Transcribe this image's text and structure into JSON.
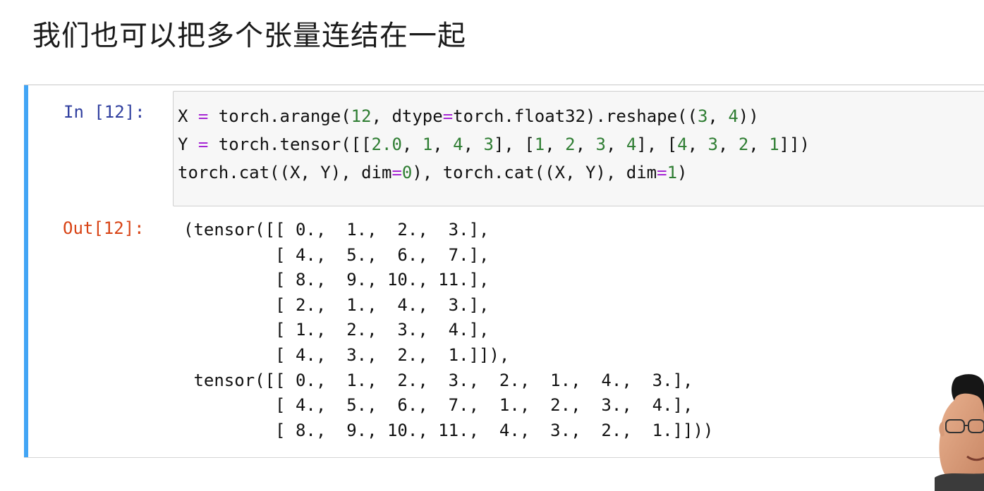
{
  "slide": {
    "title": "我们也可以把多个张量连结在一起"
  },
  "cell": {
    "in_prompt": "In [12]:",
    "out_prompt": "Out[12]:",
    "code_lines": [
      [
        {
          "t": "X ",
          "c": ""
        },
        {
          "t": "=",
          "c": "op"
        },
        {
          "t": " torch.arange(",
          "c": ""
        },
        {
          "t": "12",
          "c": "num"
        },
        {
          "t": ", dtype",
          "c": ""
        },
        {
          "t": "=",
          "c": "op"
        },
        {
          "t": "torch.float32).reshape((",
          "c": ""
        },
        {
          "t": "3",
          "c": "num"
        },
        {
          "t": ", ",
          "c": ""
        },
        {
          "t": "4",
          "c": "num"
        },
        {
          "t": "))",
          "c": ""
        }
      ],
      [
        {
          "t": "Y ",
          "c": ""
        },
        {
          "t": "=",
          "c": "op"
        },
        {
          "t": " torch.tensor([[",
          "c": ""
        },
        {
          "t": "2.0",
          "c": "num"
        },
        {
          "t": ", ",
          "c": ""
        },
        {
          "t": "1",
          "c": "num"
        },
        {
          "t": ", ",
          "c": ""
        },
        {
          "t": "4",
          "c": "num"
        },
        {
          "t": ", ",
          "c": ""
        },
        {
          "t": "3",
          "c": "num"
        },
        {
          "t": "], [",
          "c": ""
        },
        {
          "t": "1",
          "c": "num"
        },
        {
          "t": ", ",
          "c": ""
        },
        {
          "t": "2",
          "c": "num"
        },
        {
          "t": ", ",
          "c": ""
        },
        {
          "t": "3",
          "c": "num"
        },
        {
          "t": ", ",
          "c": ""
        },
        {
          "t": "4",
          "c": "num"
        },
        {
          "t": "], [",
          "c": ""
        },
        {
          "t": "4",
          "c": "num"
        },
        {
          "t": ", ",
          "c": ""
        },
        {
          "t": "3",
          "c": "num"
        },
        {
          "t": ", ",
          "c": ""
        },
        {
          "t": "2",
          "c": "num"
        },
        {
          "t": ", ",
          "c": ""
        },
        {
          "t": "1",
          "c": "num"
        },
        {
          "t": "]])",
          "c": ""
        }
      ],
      [
        {
          "t": "torch.cat((X, Y), dim",
          "c": ""
        },
        {
          "t": "=",
          "c": "op"
        },
        {
          "t": "0",
          "c": "num"
        },
        {
          "t": "), torch.cat((X, Y), dim",
          "c": ""
        },
        {
          "t": "=",
          "c": "op"
        },
        {
          "t": "1",
          "c": "num"
        },
        {
          "t": ")",
          "c": ""
        }
      ]
    ],
    "output_lines": [
      "(tensor([[ 0.,  1.,  2.,  3.],",
      "         [ 4.,  5.,  6.,  7.],",
      "         [ 8.,  9., 10., 11.],",
      "         [ 2.,  1.,  4.,  3.],",
      "         [ 1.,  2.,  3.,  4.],",
      "         [ 4.,  3.,  2.,  1.]]),",
      " tensor([[ 0.,  1.,  2.,  3.,  2.,  1.,  4.,  3.],",
      "         [ 4.,  5.,  6.,  7.,  1.,  2.,  3.,  4.],",
      "         [ 8.,  9., 10., 11.,  4.,  3.,  2.,  1.]]))"
    ]
  },
  "colors": {
    "cell_bar": "#42a5f5",
    "in_prompt": "#303f9f",
    "out_prompt": "#d84315",
    "operator": "#a626d4",
    "number": "#2e7d32"
  },
  "presenter": {
    "icon": "presenter-video-icon"
  }
}
